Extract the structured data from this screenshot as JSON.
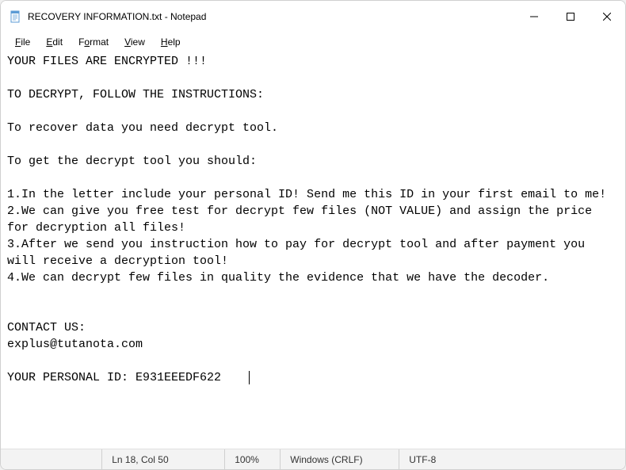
{
  "titlebar": {
    "title": "RECOVERY INFORMATION.txt - Notepad"
  },
  "menu": {
    "file": "File",
    "edit": "Edit",
    "format": "Format",
    "view": "View",
    "help": "Help"
  },
  "content": {
    "text": "YOUR FILES ARE ENCRYPTED !!!\n\nTO DECRYPT, FOLLOW THE INSTRUCTIONS:\n\nTo recover data you need decrypt tool.\n\nTo get the decrypt tool you should:\n\n1.In the letter include your personal ID! Send me this ID in your first email to me!\n2.We can give you free test for decrypt few files (NOT VALUE) and assign the price for decryption all files!\n3.After we send you instruction how to pay for decrypt tool and after payment you will receive a decryption tool!\n4.We can decrypt few files in quality the evidence that we have the decoder.\n\n\nCONTACT US:\nexplus@tutanota.com\n\nYOUR PERSONAL ID: E931EEEDF622"
  },
  "statusbar": {
    "position": "Ln 18, Col 50",
    "zoom": "100%",
    "eol": "Windows (CRLF)",
    "encoding": "UTF-8"
  }
}
